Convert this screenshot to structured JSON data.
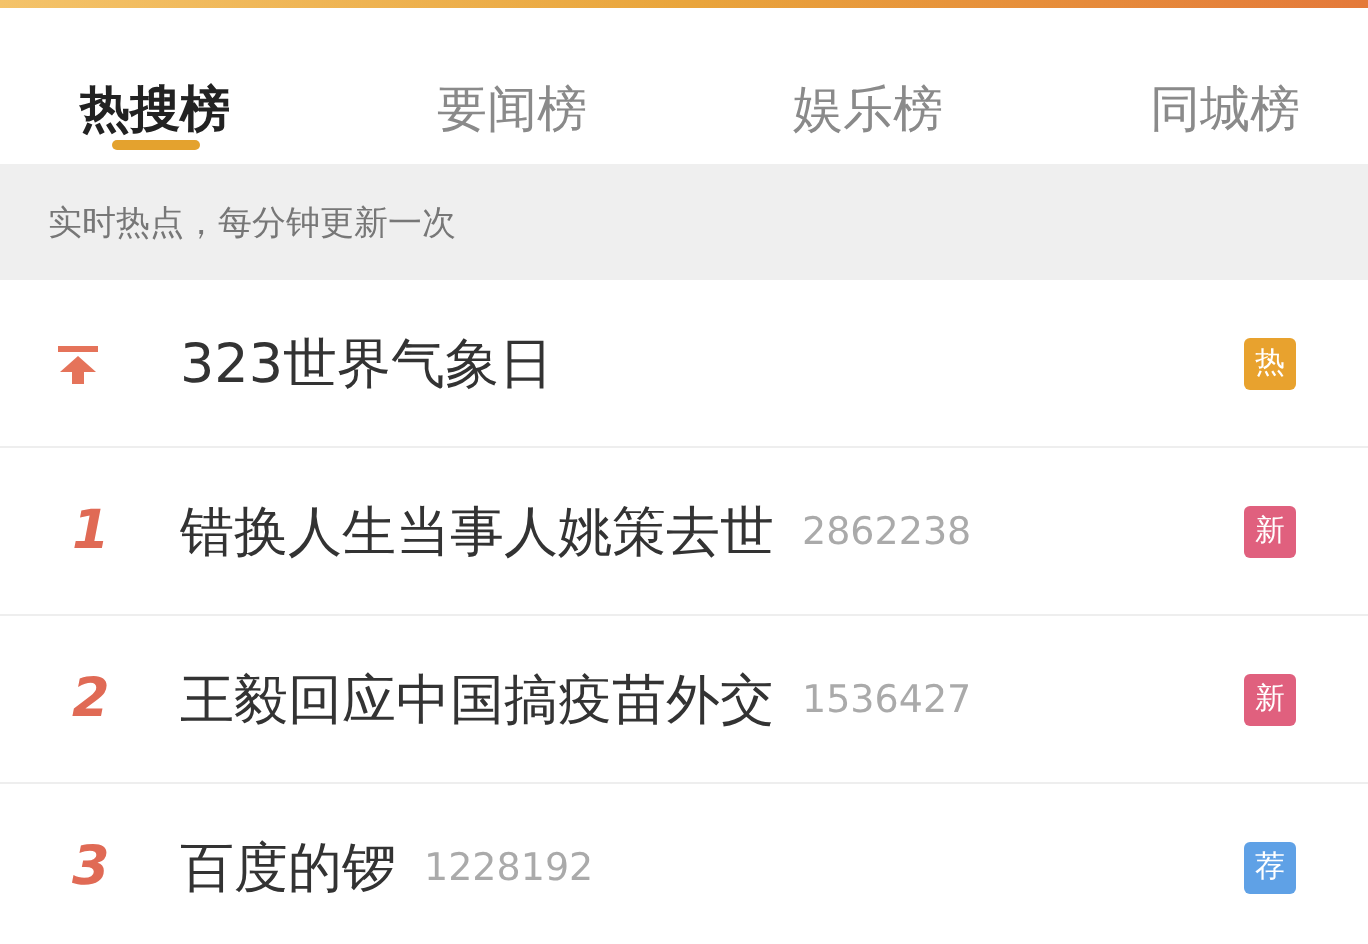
{
  "tabs": [
    {
      "label": "热搜榜",
      "selected": true
    },
    {
      "label": "要闻榜",
      "selected": false
    },
    {
      "label": "娱乐榜",
      "selected": false
    },
    {
      "label": "同城榜",
      "selected": false
    }
  ],
  "notice": "实时热点，每分钟更新一次",
  "items": [
    {
      "kind": "pinned",
      "title": "323世界气象日",
      "badge": "热",
      "color": "#e8a22e"
    },
    {
      "kind": "ranked",
      "rank": "1",
      "title": "错换人生当事人姚策去世",
      "count": "2862238",
      "badge": "新",
      "color": "#e0607e"
    },
    {
      "kind": "ranked",
      "rank": "2",
      "title": "王毅回应中国搞疫苗外交",
      "count": "1536427",
      "badge": "新",
      "color": "#e0607e"
    },
    {
      "kind": "ranked",
      "rank": "3",
      "title": "百度的锣",
      "count": "1228192",
      "badge": "荐",
      "color": "#5fa1e6"
    }
  ]
}
